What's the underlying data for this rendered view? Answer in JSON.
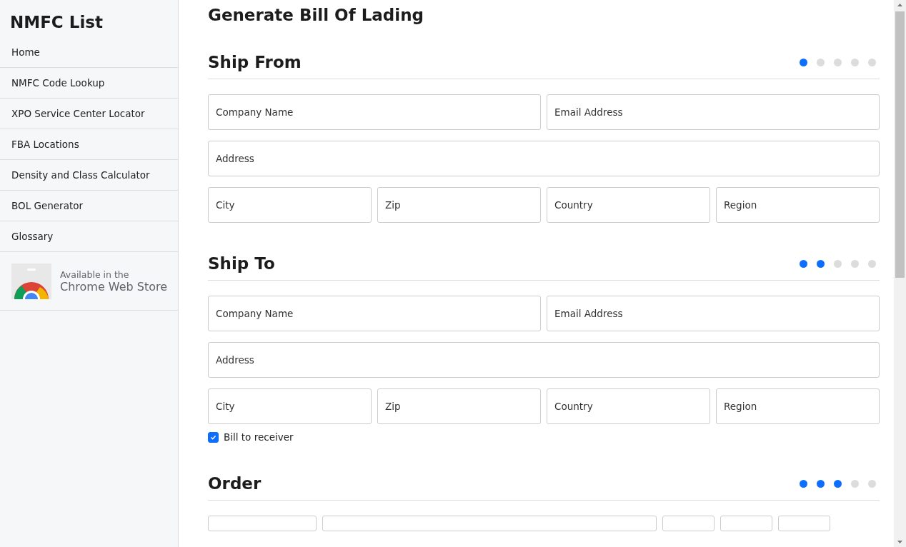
{
  "sidebar": {
    "title": "NMFC List",
    "items": [
      {
        "label": "Home"
      },
      {
        "label": "NMFC Code Lookup"
      },
      {
        "label": "XPO Service Center Locator"
      },
      {
        "label": "FBA Locations"
      },
      {
        "label": "Density and Class Calculator"
      },
      {
        "label": "BOL Generator"
      },
      {
        "label": "Glossary"
      }
    ],
    "store_badge": {
      "line_1": "Available in the",
      "line_2": "Chrome Web Store"
    }
  },
  "page_title": "Generate Bill Of Lading",
  "sections": [
    {
      "title": "Ship From",
      "steps": [
        {
          "active": true
        },
        {
          "active": false
        },
        {
          "active": false
        },
        {
          "active": false
        },
        {
          "active": false
        }
      ],
      "fields": [
        {
          "kind": "half",
          "placeholder": "Company Name"
        },
        {
          "kind": "half",
          "placeholder": "Email Address"
        },
        {
          "kind": "full",
          "placeholder": "Address"
        },
        {
          "kind": "quarter",
          "placeholder": "City"
        },
        {
          "kind": "quarter",
          "placeholder": "Zip"
        },
        {
          "kind": "quarter",
          "placeholder": "Country"
        },
        {
          "kind": "quarter",
          "placeholder": "Region"
        }
      ]
    },
    {
      "title": "Ship To",
      "steps": [
        {
          "active": true
        },
        {
          "active": true
        },
        {
          "active": false
        },
        {
          "active": false
        },
        {
          "active": false
        }
      ],
      "fields": [
        {
          "kind": "half",
          "placeholder": "Company Name"
        },
        {
          "kind": "half",
          "placeholder": "Email Address"
        },
        {
          "kind": "full",
          "placeholder": "Address"
        },
        {
          "kind": "quarter",
          "placeholder": "City"
        },
        {
          "kind": "quarter",
          "placeholder": "Zip"
        },
        {
          "kind": "quarter",
          "placeholder": "Country"
        },
        {
          "kind": "quarter",
          "placeholder": "Region"
        }
      ],
      "checkbox": {
        "label": "Bill to receiver",
        "checked": true
      }
    },
    {
      "title": "Order",
      "steps": [
        {
          "active": true
        },
        {
          "active": true
        },
        {
          "active": true
        },
        {
          "active": false
        },
        {
          "active": false
        }
      ]
    }
  ]
}
